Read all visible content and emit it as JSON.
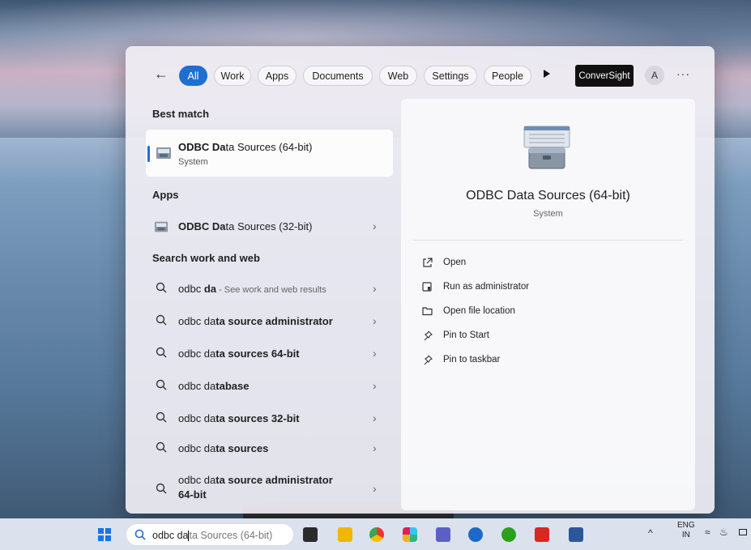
{
  "filters": {
    "back_icon": "arrow-left-icon",
    "tabs": [
      {
        "label": "All",
        "active": true
      },
      {
        "label": "Work"
      },
      {
        "label": "Apps"
      },
      {
        "label": "Documents"
      },
      {
        "label": "Web"
      },
      {
        "label": "Settings"
      },
      {
        "label": "People"
      }
    ],
    "conversight_label": "ConverSight",
    "avatar_initial": "A",
    "more_label": "···"
  },
  "best_match": {
    "title": "Best match",
    "item": {
      "name_bold": "ODBC Da",
      "name_rest": "ta Sources (64-bit)",
      "subtitle": "System"
    }
  },
  "apps": {
    "title": "Apps",
    "items": [
      {
        "name_bold": "ODBC Da",
        "name_rest": "ta Sources (32-bit)"
      }
    ]
  },
  "search_web": {
    "title": "Search work and web",
    "items": [
      {
        "prefix": "odbc ",
        "bold": "da",
        "hint": " - See work and web results"
      },
      {
        "prefix": "odbc da",
        "bold": "ta source administrator"
      },
      {
        "prefix": "odbc da",
        "bold": "ta sources 64-bit"
      },
      {
        "prefix": "odbc da",
        "bold": "tabase"
      },
      {
        "prefix": "odbc da",
        "bold": "ta sources 32-bit"
      },
      {
        "prefix": "odbc da",
        "bold": "ta sources"
      },
      {
        "prefix": "odbc da",
        "bold": "ta source administrator",
        "line2": "64-bit"
      }
    ]
  },
  "preview": {
    "title": "ODBC Data Sources (64-bit)",
    "subtitle": "System",
    "actions": [
      {
        "label": "Open",
        "icon": "open-external-icon"
      },
      {
        "label": "Run as administrator",
        "icon": "shield-run-icon"
      },
      {
        "label": "Open file location",
        "icon": "folder-icon"
      },
      {
        "label": "Pin to Start",
        "icon": "pin-icon"
      },
      {
        "label": "Pin to taskbar",
        "icon": "pin-icon"
      }
    ]
  },
  "taskbar": {
    "search_typed": "odbc da",
    "search_rest": "ta Sources (64-bit)",
    "lang_top": "ENG",
    "lang_bottom": "IN",
    "chevron": "^"
  }
}
